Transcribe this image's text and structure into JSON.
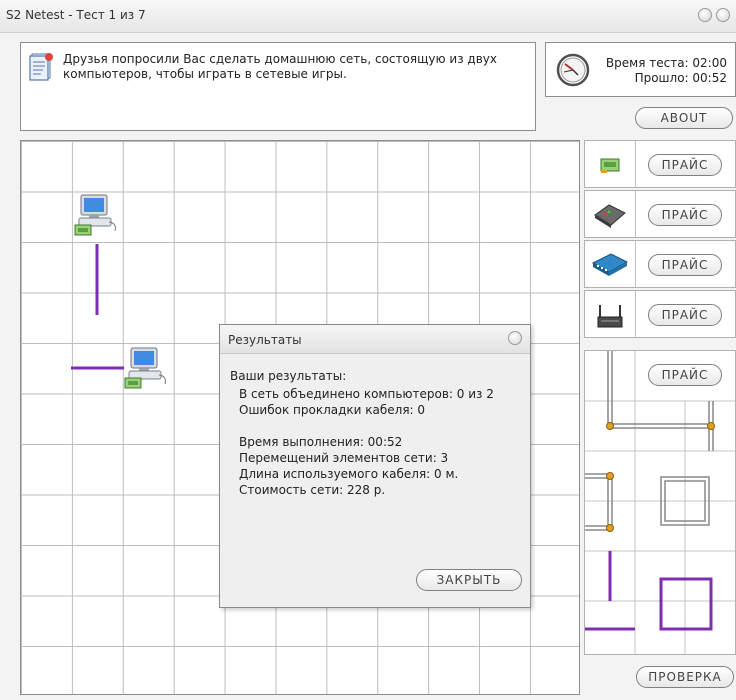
{
  "window": {
    "title": "S2 Netest - Тест 1 из 7"
  },
  "task": {
    "text": "Друзья попросили Вас сделать домашнюю сеть, состоящую из двух компьютеров, чтобы играть в сетевые игры.",
    "icon": "document-icon"
  },
  "timer": {
    "test_time": "Время теста: 02:00",
    "elapsed": "Прошло: 00:52",
    "icon": "clock-icon"
  },
  "buttons": {
    "about": "ABOUT",
    "price": "ПРАЙС",
    "check": "ПРОВЕРКА"
  },
  "palette": [
    {
      "icon": "network-card-icon"
    },
    {
      "icon": "hub-icon"
    },
    {
      "icon": "switch-icon"
    },
    {
      "icon": "router-icon"
    }
  ],
  "dialog": {
    "title": "Результаты",
    "heading": "Ваши результаты:",
    "lines": [
      "В сеть объединено компьютеров: 0 из 2",
      "Ошибок прокладки кабеля: 0"
    ],
    "stats": [
      "Время выполнения: 00:52",
      "Перемещений элементов сети: 3",
      "Длина используемого кабеля: 0 м.",
      "Стоимость сети: 228 р."
    ],
    "close": "ЗАКРЫТЬ"
  },
  "colors": {
    "cable": "#7b2fb0",
    "connector": "#e0a020",
    "grid": "#bdbdbd"
  }
}
